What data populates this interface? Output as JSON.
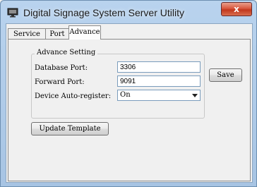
{
  "window": {
    "title": "Digital Signage System Server Utility",
    "close_glyph": "x",
    "app_icon": "monitor-icon"
  },
  "tabs": [
    {
      "label": "Service",
      "active": false
    },
    {
      "label": "Port",
      "active": false
    },
    {
      "label": "Advance",
      "active": true
    }
  ],
  "advance_setting": {
    "group_title": "Advance Setting",
    "database_port": {
      "label": "Database Port:",
      "value": "3306"
    },
    "forward_port": {
      "label": "Forward Port:",
      "value": "9091"
    },
    "device_auto_register": {
      "label": "Device Auto-register:",
      "value": "On"
    }
  },
  "buttons": {
    "save": "Save",
    "update_template": "Update Template"
  },
  "colors": {
    "title_bar": "#b9d3ee",
    "close_button": "#c8452a",
    "panel": "#f0f0f0"
  }
}
